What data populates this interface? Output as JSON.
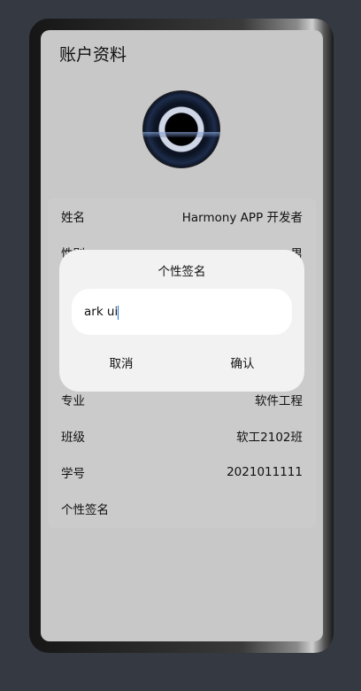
{
  "page": {
    "title": "账户资料"
  },
  "profile": {
    "rows": [
      {
        "label": "姓名",
        "value": "Harmony APP 开发者"
      },
      {
        "label": "性别",
        "value": "男"
      },
      {
        "label": "专业",
        "value": "软件工程"
      },
      {
        "label": "班级",
        "value": "软工2102班"
      },
      {
        "label": "学号",
        "value": "2021011111"
      },
      {
        "label": "个性签名",
        "value": ""
      }
    ]
  },
  "dialog": {
    "title": "个性签名",
    "input_value": "ark ui",
    "cancel_label": "取消",
    "confirm_label": "确认"
  },
  "colors": {
    "background": "#353a42",
    "screen": "#c8c8c8",
    "dialog": "#f2f2f2",
    "caret": "#1a73e8"
  }
}
